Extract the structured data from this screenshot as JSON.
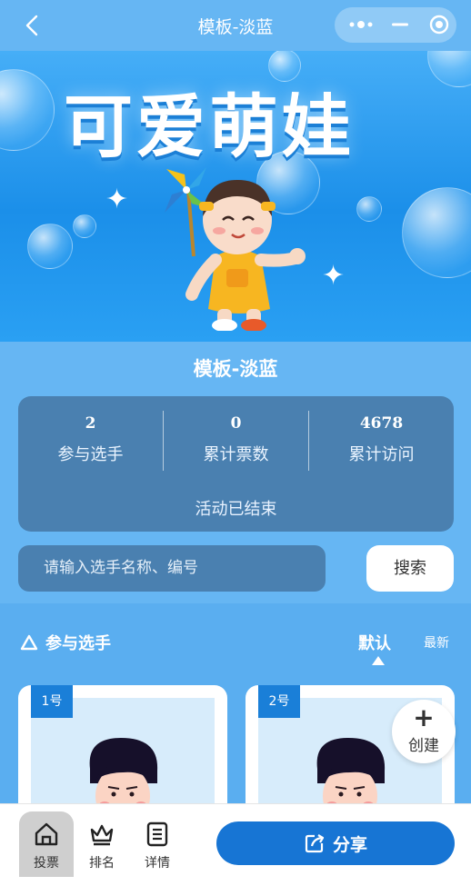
{
  "navbar": {
    "title": "模板-淡蓝"
  },
  "banner": {
    "title": "可爱萌娃"
  },
  "event": {
    "name": "模板-淡蓝"
  },
  "stats": {
    "participants": {
      "value": "2",
      "label": "参与选手"
    },
    "votes": {
      "value": "0",
      "label": "累计票数"
    },
    "visits": {
      "value": "4678",
      "label": "累计访问"
    },
    "status": "活动已结束"
  },
  "search": {
    "placeholder": "请输入选手名称、编号",
    "button_label": "搜索"
  },
  "section": {
    "title": "参与选手",
    "sort_default": "默认",
    "sort_latest": "最新"
  },
  "cards": [
    {
      "number": "1号"
    },
    {
      "number": "2号"
    }
  ],
  "create_fab": {
    "label": "创建",
    "icon": "plus"
  },
  "tabbar": {
    "tabs": [
      {
        "label": "投票",
        "icon": "home-icon",
        "active": true
      },
      {
        "label": "排名",
        "icon": "crown-icon",
        "active": false
      },
      {
        "label": "详情",
        "icon": "document-icon",
        "active": false
      }
    ],
    "share_label": "分享"
  },
  "colors": {
    "page_bg": "#66b6f3",
    "card_bg": "#4a80b0",
    "primary": "#1775d4"
  }
}
